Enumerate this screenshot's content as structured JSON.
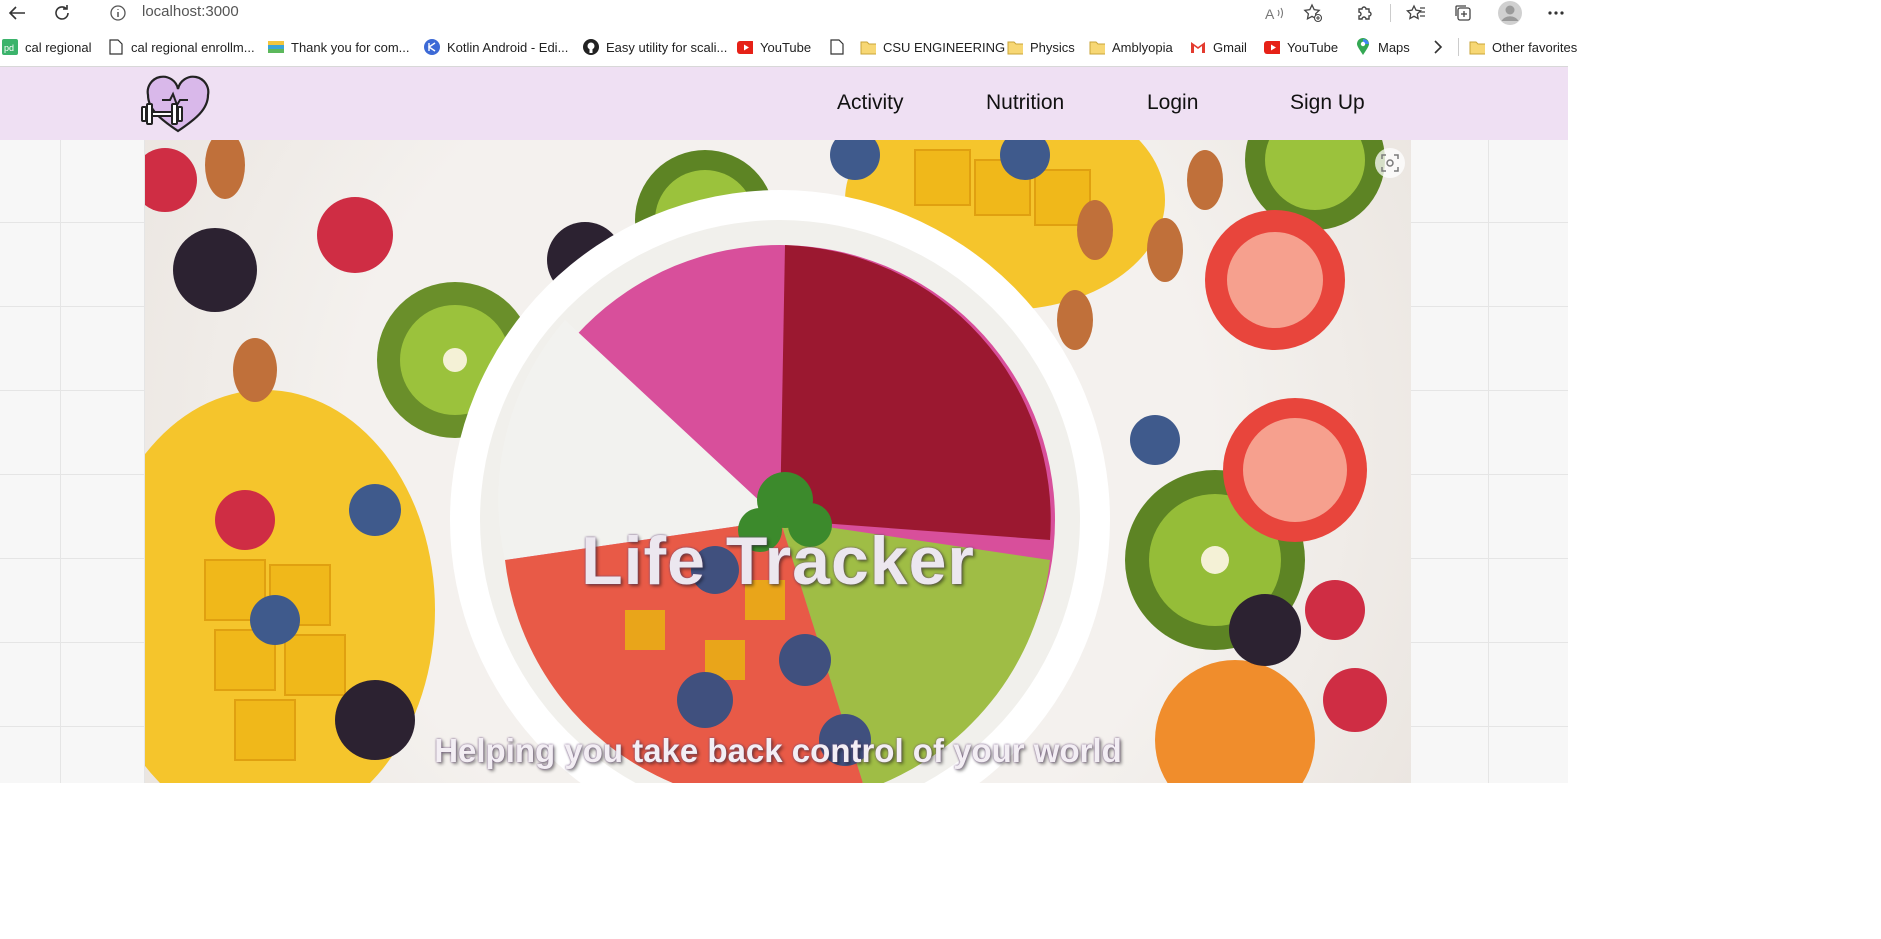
{
  "browser": {
    "url": "localhost:3000",
    "bookmarks": [
      {
        "label": "cal regional",
        "icon": "pd-app-icon"
      },
      {
        "label": "cal regional enrollm...",
        "icon": "page-icon"
      },
      {
        "label": "Thank you for com...",
        "icon": "stripe-icon"
      },
      {
        "label": "Kotlin Android - Edi...",
        "icon": "kotlin-icon"
      },
      {
        "label": "Easy utility for scali...",
        "icon": "github-icon"
      },
      {
        "label": "YouTube",
        "icon": "youtube-icon"
      },
      {
        "label": "",
        "icon": "page-icon"
      },
      {
        "label": "CSU ENGINEERING",
        "icon": "folder-icon"
      },
      {
        "label": "Physics",
        "icon": "folder-icon"
      },
      {
        "label": "Amblyopia",
        "icon": "folder-icon"
      },
      {
        "label": "Gmail",
        "icon": "gmail-icon"
      },
      {
        "label": "YouTube",
        "icon": "youtube-icon"
      },
      {
        "label": "Maps",
        "icon": "maps-icon"
      },
      {
        "label": "Other favorites",
        "icon": "folder-icon"
      }
    ]
  },
  "nav": {
    "links": [
      "Activity",
      "Nutrition",
      "Login",
      "Sign Up"
    ]
  },
  "hero": {
    "title": "Life Tracker",
    "subtitle": "Helping you take back control of your world"
  },
  "colors": {
    "navbar_bg": "#efe0f3",
    "logo_heart": "#d9b8ea",
    "accent_purple": "#6b4d7c"
  }
}
